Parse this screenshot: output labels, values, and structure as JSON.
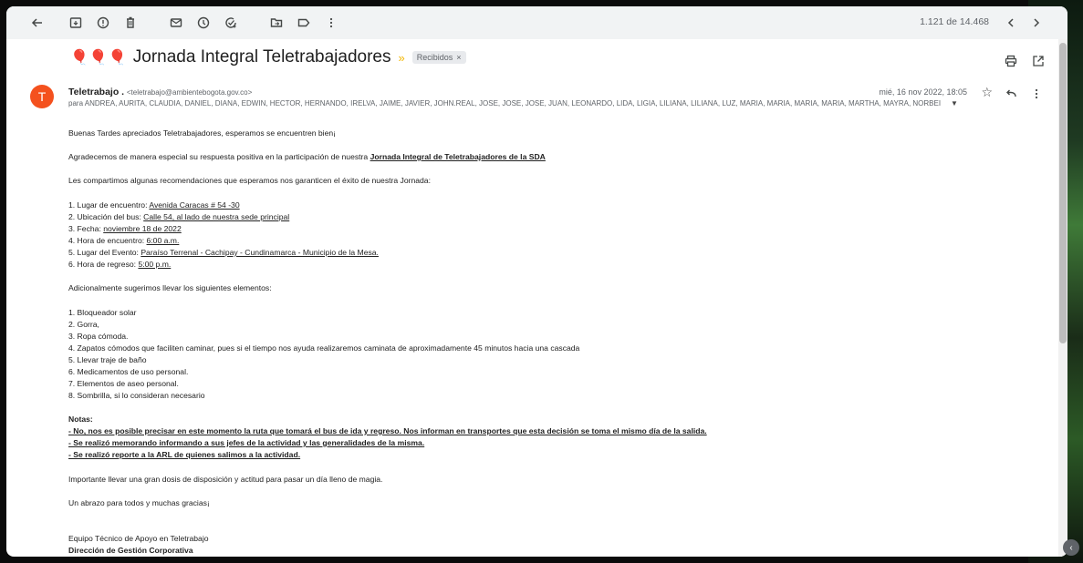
{
  "toolbar": {
    "pager": "1.121 de 14.468",
    "icons": [
      "back-arrow-icon",
      "archive-icon",
      "report-spam-icon",
      "delete-icon",
      "mark-unread-icon",
      "snooze-icon",
      "add-task-icon",
      "move-to-icon",
      "labels-icon",
      "more-vert-icon",
      "prev-icon",
      "next-icon"
    ]
  },
  "message": {
    "balloons": "🎈🎈🎈",
    "subject": "Jornada Integral Teletrabajadores",
    "label": "Recibidos",
    "label_close": "×",
    "avatar_letter": "T",
    "sender_name": "Teletrabajo .",
    "sender_email": "<teletrabajo@ambientebogota.gov.co>",
    "recipients": "para ANDREA, AURITA, CLAUDIA, DANIEL, DIANA, EDWIN, HECTOR, HERNANDO, IRELVA, JAIME, JAVIER, JOHN.REAL, JOSE, JOSE, JOSE, JUAN, LEONARDO, LIDA, LIGIA, LILIANA, LILIANA, LUZ, MARIA, MARIA, MARIA, MARIA, MARTHA, MAYRA, NORBEI",
    "date": "mié, 16 nov 2022, 18:05"
  },
  "body": {
    "greeting": "Buenas Tardes apreciados Teletrabajadores, esperamos se encuentren bien¡",
    "thanks_pre": "Agradecemos de manera especial su respuesta positiva en la participación de nuestra ",
    "thanks_bold": "Jornada Integral de Teletrabajadores de la SDA",
    "recs_intro": "Les compartimos algunas recomendaciones que esperamos nos garanticen el éxito de nuestra Jornada:",
    "recs": [
      {
        "label": "1. Lugar de encuentro: ",
        "value": "Avenida Caracas # 54 -30 "
      },
      {
        "label": "2. Ubicación del bus: ",
        "value": "Calle 54, al lado de nuestra sede principal"
      },
      {
        "label": "3. Fecha: ",
        "value": "noviembre 18 de 2022"
      },
      {
        "label": "4. Hora de encuentro: ",
        "value": "6:00 a.m."
      },
      {
        "label": "5. Lugar del Evento: ",
        "value": "Paraíso Terrenal - Cachipay  - Cundinamarca - Municipio de la Mesa."
      },
      {
        "label": "6. Hora de regreso: ",
        "value": "5:00 p.m."
      }
    ],
    "items_intro": "Adicionalmente sugerimos llevar los siguientes elementos:",
    "items": [
      "1. Bloqueador solar",
      "2. Gorra,",
      "3. Ropa cómoda.",
      "4. Zapatos cómodos que faciliten caminar, pues si el tiempo nos ayuda realizaremos caminata de aproximadamente 45 minutos hacia una cascada",
      "5. Llevar traje de baño",
      "6. Medicamentos de uso personal.",
      "7. Elementos de aseo personal.",
      "8. Sombrilla, si lo consideran necesario"
    ],
    "notes_title": "Notas:",
    "notes": [
      "- No, nos es posible precisar en este momento la ruta que tomará el bus de ida y regreso. Nos informan en transportes que esta decisión se toma el mismo día de la salida.",
      "- Se realizó memorando informando a sus jefes de la actividad y las generalidades de la misma.",
      "- Se realizó reporte a la ARL de quienes salimos a la actividad."
    ],
    "important": "Importante llevar una gran dosis de disposición y actitud para pasar un día lleno de magia.",
    "hug": "Un abrazo para todos y muchas gracias¡",
    "sig1": "Equipo Técnico de Apoyo en Teletrabajo",
    "sig2": "Dirección de Gestión Corporativa"
  },
  "colors": {
    "avatar": "#f4511e",
    "importance": "#f2b600",
    "balloon": "#d93025"
  }
}
